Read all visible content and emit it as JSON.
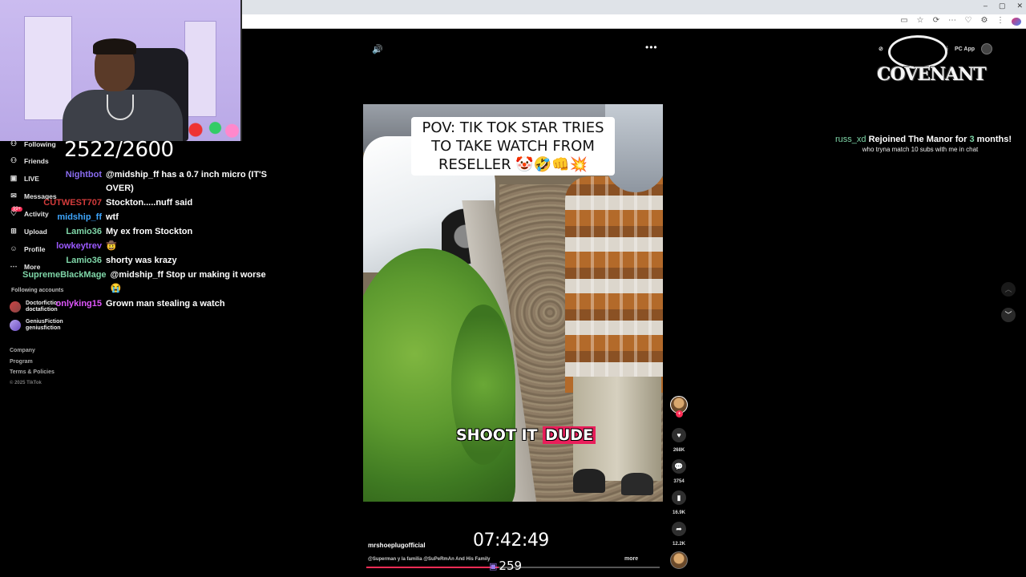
{
  "browser": {
    "window_controls": [
      "–",
      "▢",
      "✕"
    ],
    "toolbar_icons": [
      "▭",
      "☆",
      "⟳",
      "⋯",
      "♡",
      "⚙",
      "⋮"
    ]
  },
  "sidebar": {
    "items": [
      {
        "label": "Following",
        "icon": "users-icon",
        "glyph": "⚇"
      },
      {
        "label": "Friends",
        "icon": "friends-icon",
        "glyph": "👥"
      },
      {
        "label": "LIVE",
        "icon": "live-icon",
        "glyph": "▣"
      },
      {
        "label": "Messages",
        "icon": "messages-icon",
        "glyph": "✉"
      },
      {
        "label": "Activity",
        "icon": "activity-icon",
        "glyph": "♡"
      },
      {
        "label": "Upload",
        "icon": "upload-icon",
        "glyph": "⊞"
      },
      {
        "label": "Profile",
        "icon": "profile-icon",
        "glyph": "☺"
      },
      {
        "label": "More",
        "icon": "more-icon",
        "glyph": "⋯"
      }
    ],
    "badge": "99+",
    "following_header": "Following accounts",
    "accounts": [
      {
        "name": "Doctorfiction",
        "handle": "doctafiction"
      },
      {
        "name": "GeniusFiction",
        "handle": "geniusfiction"
      }
    ],
    "footer": [
      "Company",
      "Program",
      "Terms & Policies",
      "© 2025 TikTok"
    ]
  },
  "overlay": {
    "sub_counter": "2522/2600",
    "chat": [
      {
        "user": "Nightbot",
        "color": "#8a6cf0",
        "text": "@midship_ff has a 0.7 inch micro (IT'S OVER)"
      },
      {
        "user": "CUTWEST707",
        "color": "#d33b3b",
        "text": "Stockton.....nuff said"
      },
      {
        "user": "midship_ff",
        "color": "#3ea6ff",
        "text": "wtf"
      },
      {
        "user": "Lamio36",
        "color": "#7fd6a8",
        "text": "My ex from Stockton"
      },
      {
        "user": "lowkeytrev",
        "color": "#9b59ff",
        "text": "🤠"
      },
      {
        "user": "Lamio36",
        "color": "#7fd6a8",
        "text": "shorty was krazy"
      },
      {
        "user": "SupremeBlackMage",
        "color": "#7fd6a8",
        "text": "@midship_ff Stop ur making it worse 😭"
      },
      {
        "user": "onlyking15",
        "color": "#e056fd",
        "text": "Grown man stealing a watch"
      }
    ],
    "stream_clock": "07:42:49",
    "viewer_count": "259",
    "alert": {
      "user": "russ_xd",
      "text_before": " Rejoined The Manor for ",
      "months": "3",
      "text_after": " months!",
      "message": "who tryna match 10 subs with me in chat"
    },
    "logo_text": "COVENANT"
  },
  "video": {
    "caption": "POV: TIK TOK STAR TRIES TO TAKE WATCH FROM RESELLER 🤡🤣👊💥",
    "subtitle_plain": "SHOOT IT ",
    "subtitle_highlight": "DUDE",
    "author": "mrshoeplugofficial",
    "description": "@Superman y la familia @SuPeRmAn And His Family",
    "more_label": "more",
    "progress": 0.45,
    "actions": {
      "likes": "268K",
      "comments": "3754",
      "saves": "16.9K",
      "shares": "12.2K"
    }
  },
  "topbar": {
    "pc_app_label": "PC App"
  }
}
